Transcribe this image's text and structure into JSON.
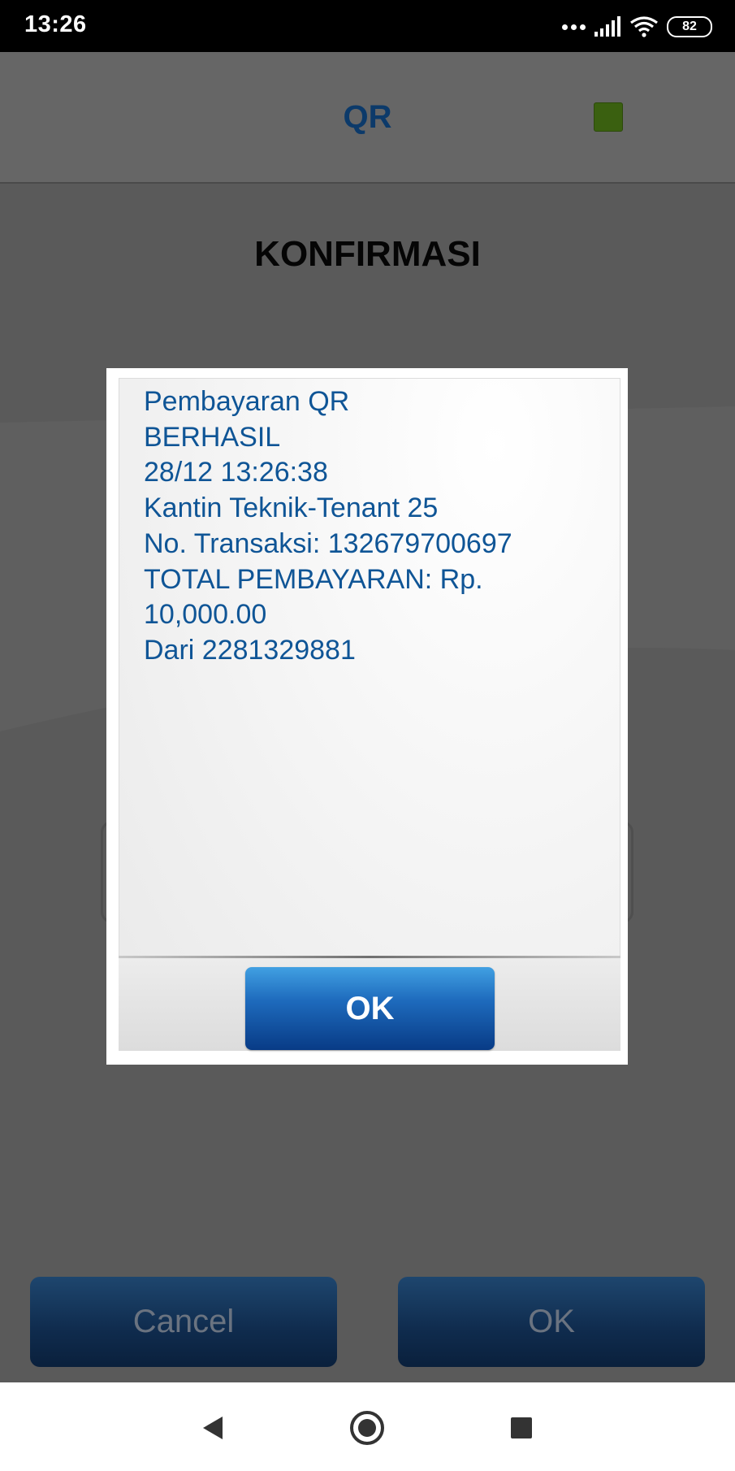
{
  "status_bar": {
    "time": "13:26",
    "battery": "82"
  },
  "header": {
    "title": "QR"
  },
  "page": {
    "title": "KONFIRMASI"
  },
  "dialog": {
    "lines": [
      "Pembayaran QR",
      "BERHASIL",
      "28/12 13:26:38",
      "Kantin Teknik-Tenant 25",
      "No. Transaksi: 132679700697",
      "TOTAL PEMBAYARAN: Rp.",
      "10,000.00",
      "Dari 2281329881"
    ],
    "ok_label": "OK"
  },
  "buttons": {
    "cancel_label": "Cancel",
    "ok_label": "OK"
  },
  "colors": {
    "dialog_text": "#0f5596",
    "header_title": "#0c3a6a",
    "status_indicator": "#3a6010"
  },
  "icons": [
    "signal-dots-icon",
    "signal-bars-icon",
    "wifi-icon",
    "battery-icon",
    "back-icon",
    "home-icon",
    "recents-icon"
  ]
}
